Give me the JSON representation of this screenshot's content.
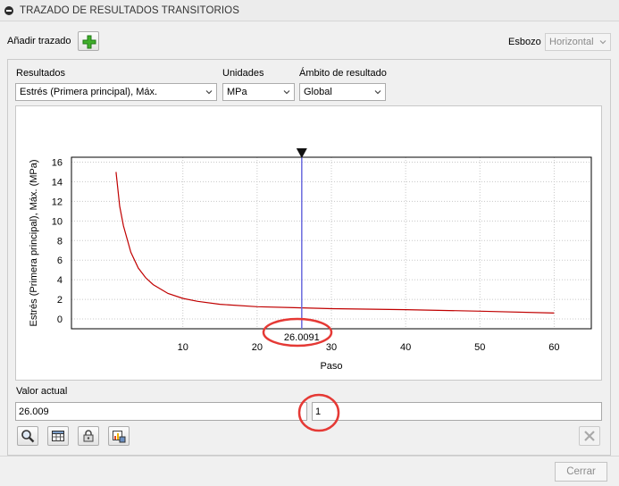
{
  "header": {
    "title": "TRAZADO DE RESULTADOS TRANSITORIOS"
  },
  "toolbar": {
    "add_trace_label": "Añadir trazado",
    "sketch_label": "Esbozo",
    "sketch_value": "Horizontal"
  },
  "filters": {
    "results_label": "Resultados",
    "results_value": "Estrés (Primera principal), Máx.",
    "units_label": "Unidades",
    "units_value": "MPa",
    "scope_label": "Ámbito de resultado",
    "scope_value": "Global"
  },
  "chart_data": {
    "type": "line",
    "xlabel": "Paso",
    "ylabel": "Estrés (Primera principal), Máx. (MPa)",
    "xlim": [
      -5,
      65
    ],
    "ylim": [
      -1,
      16.5
    ],
    "x_ticks": [
      10,
      20,
      30,
      40,
      50,
      60
    ],
    "y_ticks": [
      0,
      2,
      4,
      6,
      8,
      10,
      12,
      14,
      16
    ],
    "grid": true,
    "marker_x": 26.0091,
    "marker_label": "26.0091",
    "series": [
      {
        "color": "#c00000",
        "x": [
          1,
          1.5,
          2,
          3,
          4,
          5,
          6,
          8,
          10,
          12,
          15,
          20,
          25,
          30,
          40,
          50,
          60
        ],
        "y": [
          15.0,
          11.5,
          9.5,
          6.8,
          5.2,
          4.2,
          3.5,
          2.6,
          2.1,
          1.8,
          1.5,
          1.25,
          1.15,
          1.05,
          0.95,
          0.8,
          0.6
        ]
      }
    ]
  },
  "current_value": {
    "label": "Valor actual",
    "value": "26.009",
    "step": "1"
  },
  "footer": {
    "close_label": "Cerrar"
  }
}
